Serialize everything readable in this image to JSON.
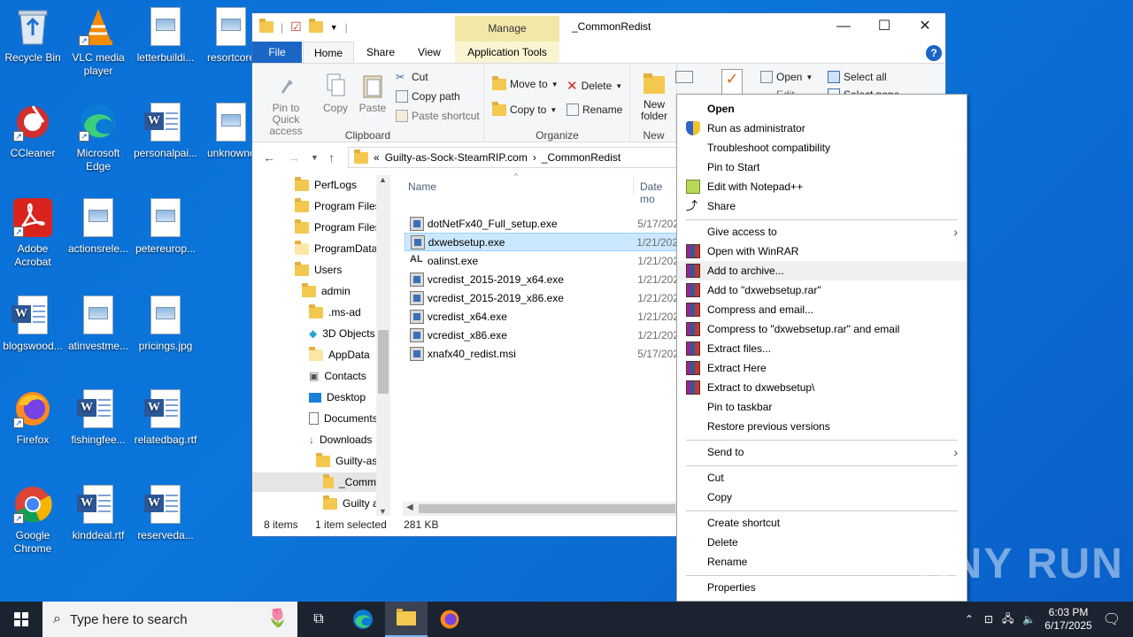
{
  "desktop": {
    "icons": [
      {
        "label": "Recycle Bin"
      },
      {
        "label": "VLC media player"
      },
      {
        "label": "letterbuildi..."
      },
      {
        "label": "resortcore"
      },
      {
        "label": "CCleaner"
      },
      {
        "label": "Microsoft Edge"
      },
      {
        "label": "personalpai..."
      },
      {
        "label": "unknownc"
      },
      {
        "label": "Adobe Acrobat"
      },
      {
        "label": "actionsrele..."
      },
      {
        "label": "petereurop..."
      },
      {
        "label": "blogswood..."
      },
      {
        "label": "atinvestme..."
      },
      {
        "label": "pricings.jpg"
      },
      {
        "label": "Firefox"
      },
      {
        "label": "fishingfee..."
      },
      {
        "label": "relatedbag.rtf"
      },
      {
        "label": "Google Chrome"
      },
      {
        "label": "kinddeal.rtf"
      },
      {
        "label": "reserveda..."
      }
    ]
  },
  "explorer": {
    "manage_tab": "Manage",
    "title": "_CommonRedist",
    "tabs": {
      "file": "File",
      "home": "Home",
      "share": "Share",
      "view": "View",
      "app_tools": "Application Tools"
    },
    "ribbon": {
      "pin_quick_access": "Pin to Quick access",
      "copy": "Copy",
      "paste": "Paste",
      "cut": "Cut",
      "copy_path": "Copy path",
      "paste_shortcut": "Paste shortcut",
      "clipboard_group": "Clipboard",
      "move_to": "Move to",
      "copy_to": "Copy to",
      "delete": "Delete",
      "rename": "Rename",
      "organize_group": "Organize",
      "new_folder": "New folder",
      "new_group": "New",
      "open": "Open",
      "edit": "Edit",
      "select_all": "Select all",
      "select_none": "Select none"
    },
    "address": {
      "prefix": "«",
      "crumb1": "Guilty-as-Sock-SteamRIP.com",
      "sep": "›",
      "crumb2": "_CommonRedist"
    },
    "nav_items": [
      {
        "label": "PerfLogs"
      },
      {
        "label": "Program Files"
      },
      {
        "label": "Program Files"
      },
      {
        "label": "ProgramData"
      },
      {
        "label": "Users"
      },
      {
        "label": "admin"
      },
      {
        "label": ".ms-ad"
      },
      {
        "label": "3D Objects"
      },
      {
        "label": "AppData"
      },
      {
        "label": "Contacts"
      },
      {
        "label": "Desktop"
      },
      {
        "label": "Documents"
      },
      {
        "label": "Downloads"
      },
      {
        "label": "Guilty-as"
      },
      {
        "label": "_Comm"
      },
      {
        "label": "Guilty a"
      }
    ],
    "columns": {
      "name": "Name",
      "date": "Date mo"
    },
    "files": [
      {
        "name": "dotNetFx40_Full_setup.exe",
        "date": "5/17/202"
      },
      {
        "name": "dxwebsetup.exe",
        "date": "1/21/202"
      },
      {
        "name": "oalinst.exe",
        "date": "1/21/202"
      },
      {
        "name": "vcredist_2015-2019_x64.exe",
        "date": "1/21/202"
      },
      {
        "name": "vcredist_2015-2019_x86.exe",
        "date": "1/21/202"
      },
      {
        "name": "vcredist_x64.exe",
        "date": "1/21/202"
      },
      {
        "name": "vcredist_x86.exe",
        "date": "1/21/202"
      },
      {
        "name": "xnafx40_redist.msi",
        "date": "5/17/202"
      }
    ],
    "status": {
      "count": "8 items",
      "selected": "1 item selected",
      "size": "281 KB"
    }
  },
  "context_menu": {
    "items": [
      {
        "label": "Open"
      },
      {
        "label": "Run as administrator"
      },
      {
        "label": "Troubleshoot compatibility"
      },
      {
        "label": "Pin to Start"
      },
      {
        "label": "Edit with Notepad++"
      },
      {
        "label": "Share"
      },
      {
        "label": "Give access to"
      },
      {
        "label": "Open with WinRAR"
      },
      {
        "label": "Add to archive..."
      },
      {
        "label": "Add to \"dxwebsetup.rar\""
      },
      {
        "label": "Compress and email..."
      },
      {
        "label": "Compress to \"dxwebsetup.rar\" and email"
      },
      {
        "label": "Extract files..."
      },
      {
        "label": "Extract Here"
      },
      {
        "label": "Extract to dxwebsetup\\"
      },
      {
        "label": "Pin to taskbar"
      },
      {
        "label": "Restore previous versions"
      },
      {
        "label": "Send to"
      },
      {
        "label": "Cut"
      },
      {
        "label": "Copy"
      },
      {
        "label": "Create shortcut"
      },
      {
        "label": "Delete"
      },
      {
        "label": "Rename"
      },
      {
        "label": "Properties"
      }
    ]
  },
  "taskbar": {
    "search_placeholder": "Type here to search",
    "time": "6:03 PM",
    "date": "6/17/2025"
  },
  "watermark": "ANY RUN"
}
